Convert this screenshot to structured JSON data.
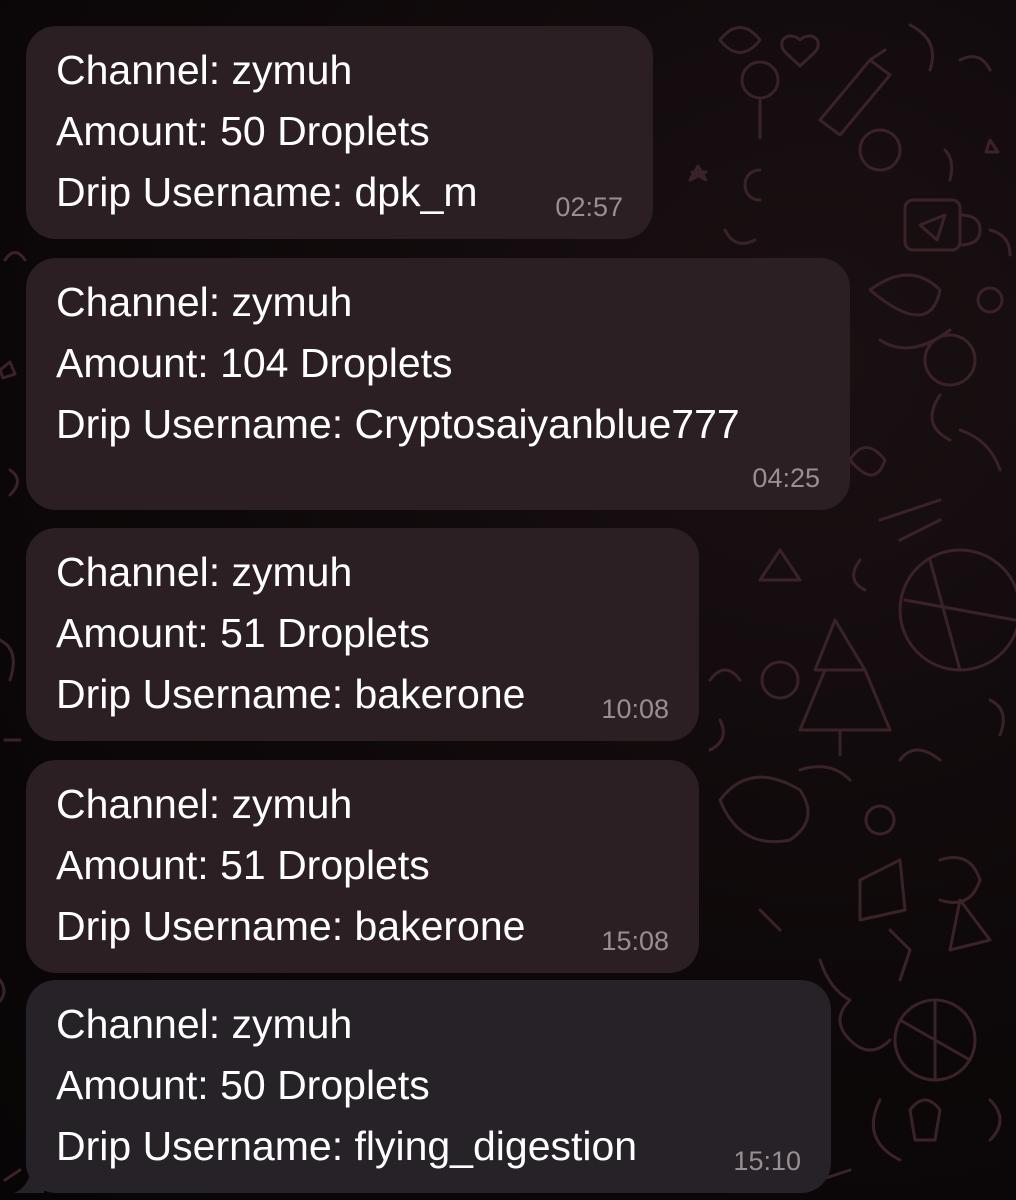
{
  "theme": {
    "bubble_color": "#2b1f24",
    "bubble_color_last": "#262228",
    "text_color": "#ffffff",
    "time_color": "#9b8e93",
    "background_color": "#0b0709"
  },
  "messages": [
    {
      "channel": "Channel: zymuh",
      "amount": "Amount: 50 Droplets",
      "username": "Drip Username: dpk_m",
      "time": "02:57"
    },
    {
      "channel": "Channel: zymuh",
      "amount": "Amount: 104 Droplets",
      "username": "Drip Username: Cryptosaiyanblue777",
      "time": "04:25"
    },
    {
      "channel": "Channel: zymuh",
      "amount": "Amount: 51 Droplets",
      "username": "Drip Username: bakerone",
      "time": "10:08"
    },
    {
      "channel": "Channel: zymuh",
      "amount": "Amount: 51 Droplets",
      "username": "Drip Username: bakerone",
      "time": "15:08"
    },
    {
      "channel": "Channel: zymuh",
      "amount": "Amount: 50 Droplets",
      "username": "Drip Username: flying_digestion",
      "time": "15:10"
    }
  ]
}
